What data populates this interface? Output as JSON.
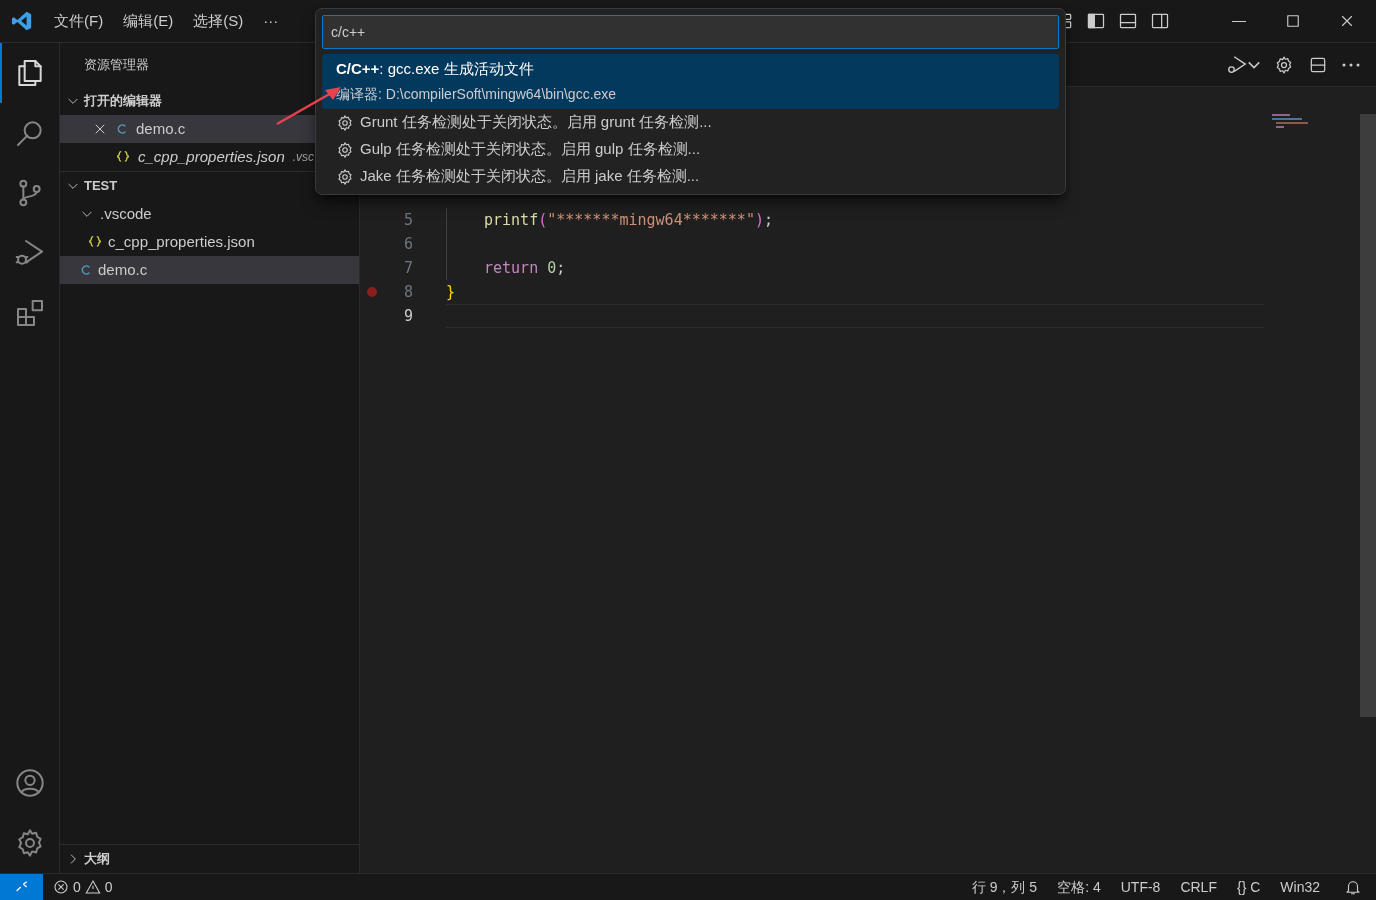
{
  "menu": [
    "文件(F)",
    "编辑(E)",
    "选择(S)",
    "···"
  ],
  "activity": [
    {
      "selected": true
    },
    {
      "selected": false
    },
    {
      "selected": false
    },
    {
      "selected": false
    },
    {
      "selected": false
    }
  ],
  "sidebar": {
    "title": "资源管理器",
    "open_editors": {
      "title": "打开的编辑器",
      "expanded": true,
      "items": [
        {
          "name": "demo.c",
          "kind": "c",
          "selected": true,
          "italic": false
        },
        {
          "name": "c_cpp_properties.json",
          "kind": "json",
          "hint": ".vsc",
          "selected": false,
          "italic": true
        }
      ]
    },
    "folder": {
      "title": "TEST",
      "expanded": true,
      "children": [
        {
          "name": ".vscode",
          "kind": "folder",
          "expanded": true,
          "selected": false,
          "children": [
            {
              "name": "c_cpp_properties.json",
              "kind": "json",
              "selected": false
            }
          ]
        },
        {
          "name": "demo.c",
          "kind": "c",
          "selected": true
        }
      ]
    },
    "outline": {
      "title": "大纲",
      "expanded": false
    }
  },
  "quick_pick": {
    "value": "c/c++",
    "items": [
      {
        "kind": "compiler",
        "label": "**C/C++**: gcc.exe 生成活动文件",
        "detail": "编译器: D:\\compilerSoft\\mingw64\\bin\\gcc.exe",
        "selected": true
      },
      {
        "kind": "task",
        "label": "Grunt 任务检测处于关闭状态。启用 grunt 任务检测...",
        "selected": false
      },
      {
        "kind": "task",
        "label": "Gulp 任务检测处于关闭状态。启用 gulp 任务检测...",
        "selected": false
      },
      {
        "kind": "task",
        "label": "Jake 任务检测处于关闭状态。启用 jake 任务检测...",
        "selected": false
      }
    ]
  },
  "code": [
    {
      "number": "5",
      "current": false,
      "breakpoint": false,
      "indented": true,
      "tokens": [
        {
          "kind": "function",
          "text": "printf"
        },
        {
          "kind": "paren",
          "text": "("
        },
        {
          "kind": "string",
          "text": "\"*******mingw64*******\""
        },
        {
          "kind": "paren",
          "text": ")"
        },
        {
          "kind": "plain",
          "text": ";"
        }
      ]
    },
    {
      "number": "6",
      "current": false,
      "breakpoint": false,
      "indented": true
    },
    {
      "number": "7",
      "current": false,
      "breakpoint": false,
      "indented": true,
      "tokens": [
        {
          "kind": "keyword",
          "text": "return"
        },
        {
          "kind": "number",
          "text": "0"
        },
        {
          "kind": "plain",
          "text": ";"
        }
      ]
    },
    {
      "number": "8",
      "current": false,
      "breakpoint": true,
      "indented": false,
      "tokens": [
        {
          "kind": "brace",
          "text": "}"
        }
      ]
    },
    {
      "number": "9",
      "current": true,
      "breakpoint": false,
      "indented": false
    }
  ],
  "status_bar": {
    "errors": "0",
    "warnings": "0",
    "items": [
      "行 9，列 5",
      "空格: 4",
      "UTF-8",
      "CRLF",
      "{} C",
      "Win32"
    ]
  }
}
